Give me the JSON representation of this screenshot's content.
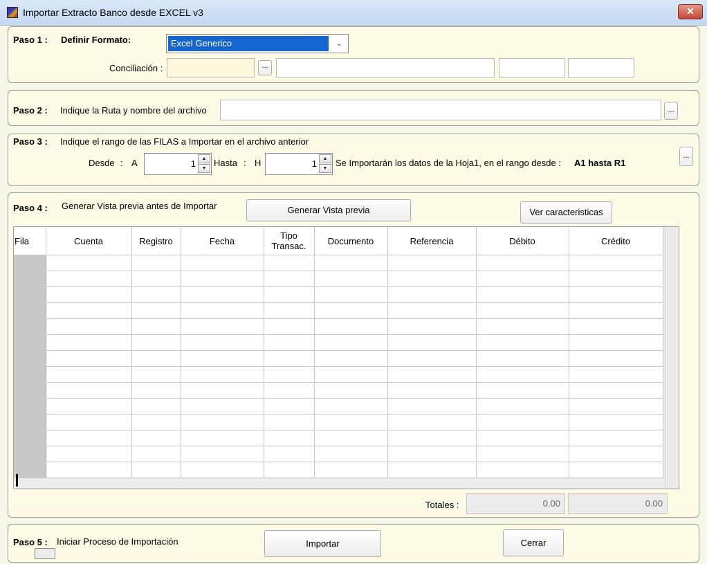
{
  "window": {
    "title": "Importar Extracto Banco desde EXCEL v3",
    "close_label": "✕"
  },
  "paso1": {
    "label": "Paso 1 :",
    "title": "Definir Formato:",
    "formato_value": "Excel Generico",
    "conciliacion_label": "Conciliación :",
    "dots": "..."
  },
  "paso2": {
    "label": "Paso 2 :",
    "text": "Indique la Ruta y nombre del archivo",
    "dots": "..."
  },
  "paso3": {
    "label": "Paso 3 :",
    "text": "Indique el rango de las FILAS a Importar en el archivo anterior",
    "desde_label": "Desde",
    "colon": ":",
    "a_label": "A",
    "desde_value": "1",
    "hasta_label": "Hasta",
    "h_label": "H",
    "hasta_value": "1",
    "info_text": "Se Importarán los datos de la Hoja1,  en el rango desde :",
    "range_text": "A1 hasta R1",
    "dots": "..."
  },
  "paso4": {
    "label": "Paso 4 :",
    "text": "Generar Vista previa antes de Importar",
    "generar_button": "Generar Vista previa",
    "ver_button": "Ver caracteristicas",
    "columns": [
      "Fila",
      "Cuenta",
      "Registro",
      "Fecha",
      "Tipo\nTransac.",
      "Documento",
      "Referencia",
      "Débito",
      "Crédito"
    ],
    "totales_label": "Totales :",
    "total_debito": "0.00",
    "total_credito": "0.00"
  },
  "paso5": {
    "label": "Paso 5 :",
    "text": "Iniciar Proceso de Importación",
    "importar_button": "Importar",
    "cerrar_button": "Cerrar"
  }
}
